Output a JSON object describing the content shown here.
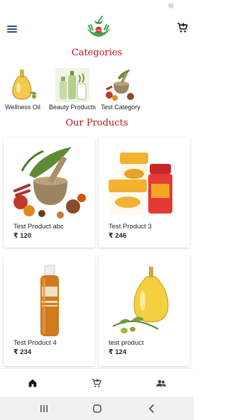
{
  "app": {
    "logo_text": "OAK"
  },
  "sections": {
    "categories_title": "Categories",
    "products_title": "Our Products"
  },
  "categories": [
    {
      "label": "Wellness Oil",
      "icon": "oil-bottle-image"
    },
    {
      "label": "Beauty Products",
      "icon": "beauty-products-image"
    },
    {
      "label": "Test Category",
      "icon": "herbs-mortar-image"
    }
  ],
  "products": [
    {
      "name": "Test Product abc",
      "price": "₹ 120",
      "image": "herbs-mortar-spices-image"
    },
    {
      "name": "Test Product 3",
      "price": "₹ 246",
      "image": "acnederma-jars-image"
    },
    {
      "name": "Test Product 4",
      "price": "₹ 234",
      "image": "serum-bottle-image"
    },
    {
      "name": "test product",
      "price": "₹ 124",
      "image": "olive-oil-bottle-image"
    }
  ],
  "bottom_nav": {
    "items": [
      "home-icon",
      "cart-icon",
      "users-icon"
    ]
  },
  "colors": {
    "accent_red": "#c0121b",
    "menu_blue": "#1f4f86",
    "logo_green": "#3fa34d"
  }
}
